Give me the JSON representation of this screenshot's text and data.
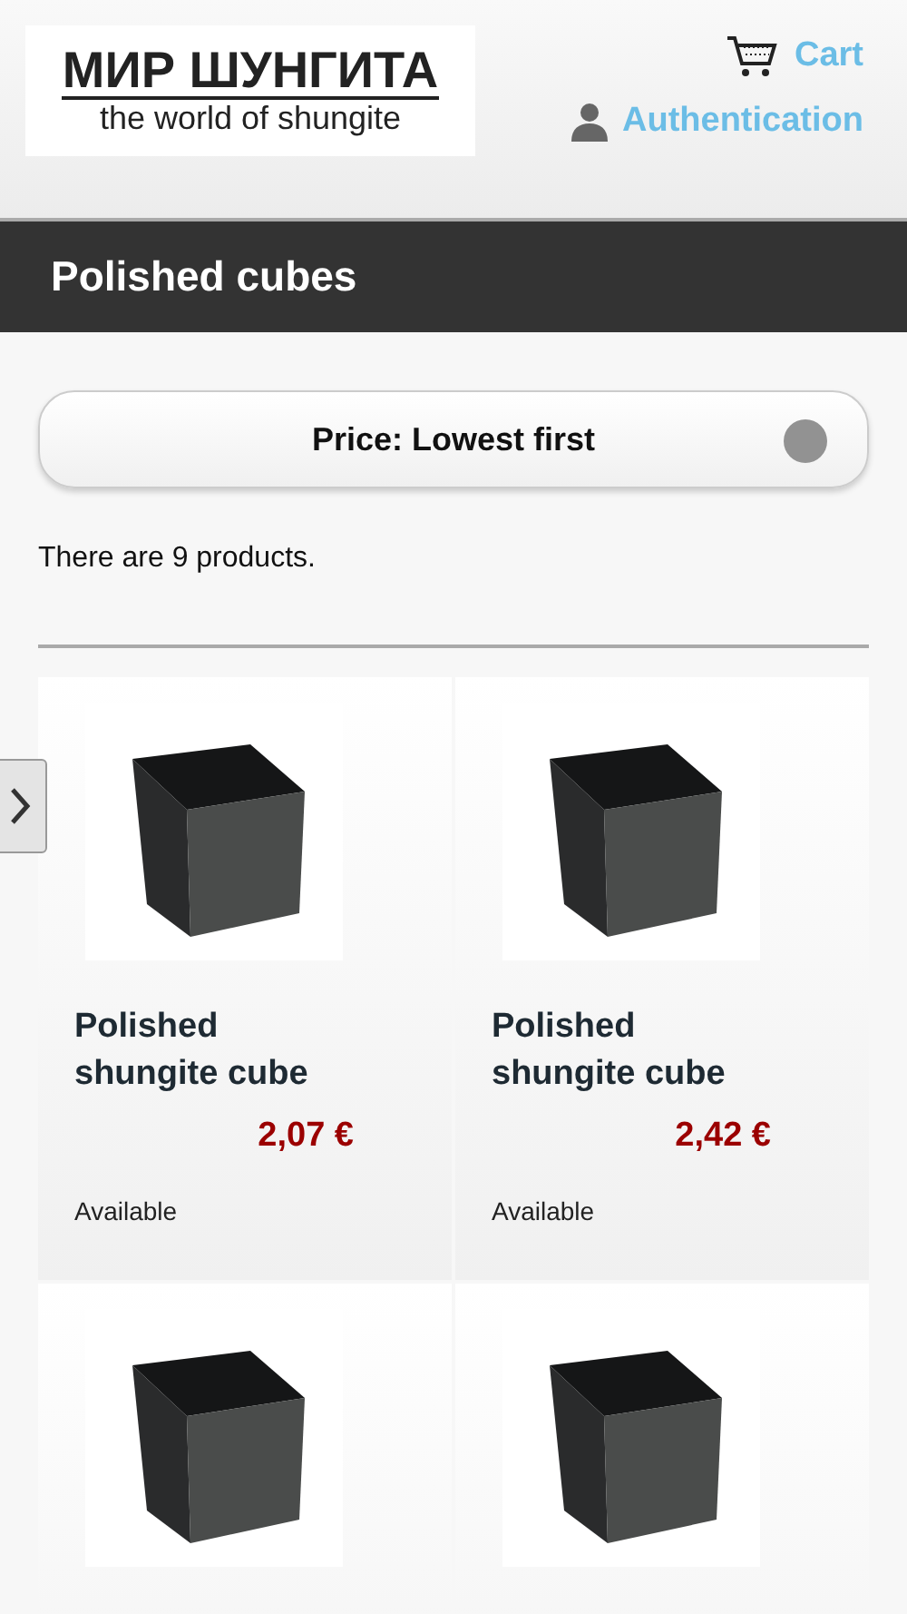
{
  "header": {
    "logo": {
      "title": "МИР ШУНГИТА",
      "subtitle": "the world of shungite"
    },
    "links": [
      {
        "kind": "cart",
        "label": "Cart"
      },
      {
        "kind": "user",
        "label": "Authentication"
      }
    ]
  },
  "category": {
    "title": "Polished cubes"
  },
  "sort": {
    "value": "Price: Lowest first"
  },
  "count": "There are 9 products.",
  "products": [
    {
      "kind": "full",
      "name": "Polished shungite cube",
      "price": "2,07 €",
      "availability": "Available"
    },
    {
      "kind": "full",
      "name": "Polished shungite cube",
      "price": "2,42 €",
      "availability": "Available"
    },
    {
      "kind": "photo_only"
    },
    {
      "kind": "photo_only"
    }
  ]
}
